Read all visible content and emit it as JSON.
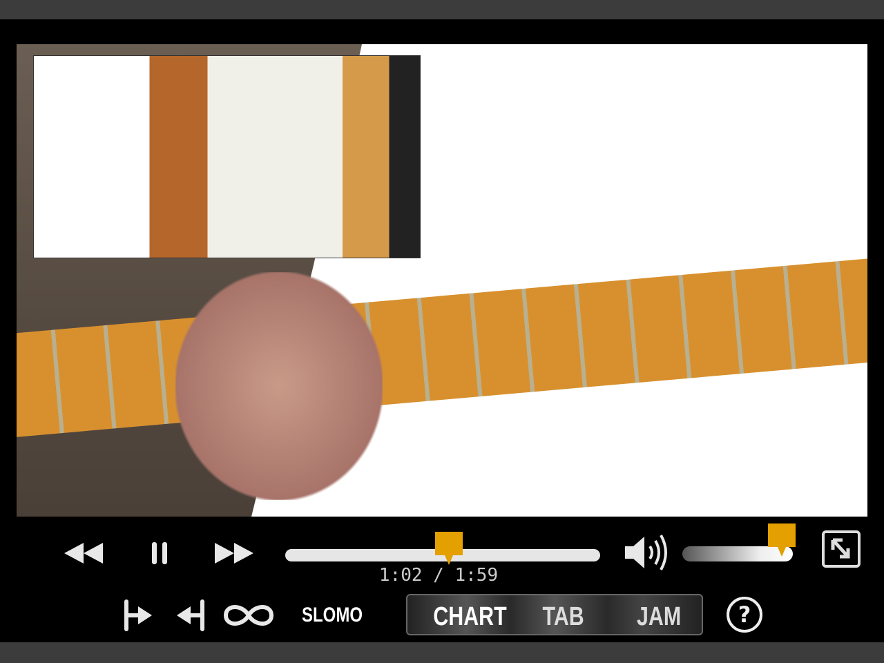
{
  "player": {
    "accent_color": "#e3a000",
    "current_time": "1:02",
    "separator": "/",
    "duration": "1:59",
    "progress_percent": 52,
    "volume_percent": 90,
    "state": "playing"
  },
  "controls": {
    "rewind_icon": "rewind-icon",
    "pause_icon": "pause-icon",
    "fast_forward_icon": "fast-forward-icon",
    "volume_icon": "volume-icon",
    "fullscreen_icon": "exit-fullscreen-icon",
    "loop_start_icon": "loop-start-icon",
    "loop_end_icon": "loop-end-icon",
    "loop_icon": "infinity-loop-icon",
    "slomo_label": "SLOMO",
    "help_label": "?"
  },
  "view_tabs": [
    {
      "label": "CHART",
      "active": true
    },
    {
      "label": "TAB",
      "active": false
    },
    {
      "label": "JAM",
      "active": false
    }
  ]
}
